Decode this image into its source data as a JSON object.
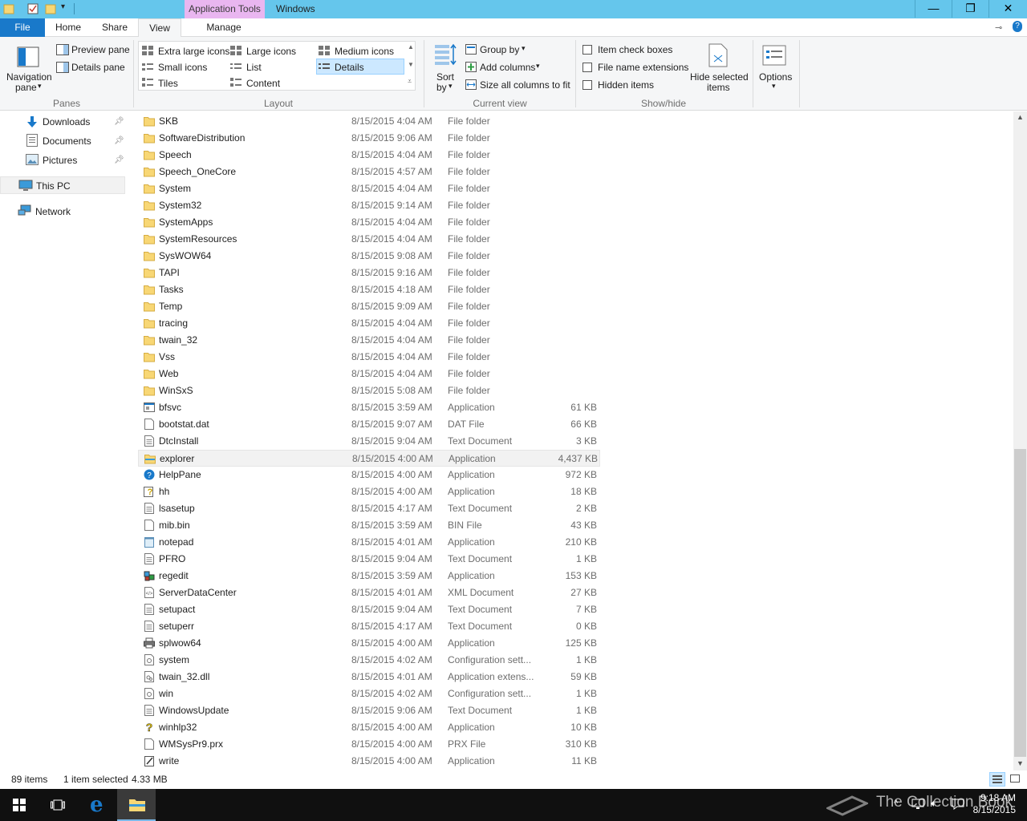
{
  "titlebar": {
    "context_tab": "Application Tools",
    "title": "Windows",
    "buttons": {
      "minimize": "—",
      "restore": "❐",
      "close": "✕"
    }
  },
  "tabs": {
    "file": "File",
    "home": "Home",
    "share": "Share",
    "view": "View",
    "manage": "Manage"
  },
  "ribbon": {
    "panes": {
      "navigation_pane": "Navigation",
      "navigation_pane2": "pane",
      "preview_pane": "Preview pane",
      "details_pane": "Details pane",
      "group": "Panes"
    },
    "layout": {
      "extra_large": "Extra large icons",
      "large": "Large icons",
      "medium": "Medium icons",
      "small": "Small icons",
      "list": "List",
      "details": "Details",
      "tiles": "Tiles",
      "content": "Content",
      "group": "Layout"
    },
    "current_view": {
      "sort_by": "Sort",
      "sort_by2": "by",
      "group_by": "Group by",
      "add_columns": "Add columns",
      "size_all": "Size all columns to fit",
      "group": "Current view"
    },
    "show_hide": {
      "item_check_boxes": "Item check boxes",
      "file_name_extensions": "File name extensions",
      "hidden_items": "Hidden items",
      "hide_selected": "Hide selected",
      "hide_selected2": "items",
      "group": "Show/hide"
    },
    "options": "Options"
  },
  "nav": {
    "items": [
      {
        "label": "Downloads",
        "icon": "download-arrow-icon",
        "pinned": true
      },
      {
        "label": "Documents",
        "icon": "documents-icon",
        "pinned": true
      },
      {
        "label": "Pictures",
        "icon": "pictures-icon",
        "pinned": true
      },
      {
        "label": "This PC",
        "icon": "computer-icon",
        "pinned": false
      },
      {
        "label": "Network",
        "icon": "network-icon",
        "pinned": false
      }
    ]
  },
  "files": [
    {
      "name": "SKB",
      "date": "8/15/2015 4:04 AM",
      "type": "File folder",
      "size": "",
      "icon": "folder"
    },
    {
      "name": "SoftwareDistribution",
      "date": "8/15/2015 9:06 AM",
      "type": "File folder",
      "size": "",
      "icon": "folder"
    },
    {
      "name": "Speech",
      "date": "8/15/2015 4:04 AM",
      "type": "File folder",
      "size": "",
      "icon": "folder"
    },
    {
      "name": "Speech_OneCore",
      "date": "8/15/2015 4:57 AM",
      "type": "File folder",
      "size": "",
      "icon": "folder"
    },
    {
      "name": "System",
      "date": "8/15/2015 4:04 AM",
      "type": "File folder",
      "size": "",
      "icon": "folder"
    },
    {
      "name": "System32",
      "date": "8/15/2015 9:14 AM",
      "type": "File folder",
      "size": "",
      "icon": "folder"
    },
    {
      "name": "SystemApps",
      "date": "8/15/2015 4:04 AM",
      "type": "File folder",
      "size": "",
      "icon": "folder"
    },
    {
      "name": "SystemResources",
      "date": "8/15/2015 4:04 AM",
      "type": "File folder",
      "size": "",
      "icon": "folder"
    },
    {
      "name": "SysWOW64",
      "date": "8/15/2015 9:08 AM",
      "type": "File folder",
      "size": "",
      "icon": "folder"
    },
    {
      "name": "TAPI",
      "date": "8/15/2015 9:16 AM",
      "type": "File folder",
      "size": "",
      "icon": "folder"
    },
    {
      "name": "Tasks",
      "date": "8/15/2015 4:18 AM",
      "type": "File folder",
      "size": "",
      "icon": "folder"
    },
    {
      "name": "Temp",
      "date": "8/15/2015 9:09 AM",
      "type": "File folder",
      "size": "",
      "icon": "folder"
    },
    {
      "name": "tracing",
      "date": "8/15/2015 4:04 AM",
      "type": "File folder",
      "size": "",
      "icon": "folder"
    },
    {
      "name": "twain_32",
      "date": "8/15/2015 4:04 AM",
      "type": "File folder",
      "size": "",
      "icon": "folder"
    },
    {
      "name": "Vss",
      "date": "8/15/2015 4:04 AM",
      "type": "File folder",
      "size": "",
      "icon": "folder"
    },
    {
      "name": "Web",
      "date": "8/15/2015 4:04 AM",
      "type": "File folder",
      "size": "",
      "icon": "folder"
    },
    {
      "name": "WinSxS",
      "date": "8/15/2015 5:08 AM",
      "type": "File folder",
      "size": "",
      "icon": "folder"
    },
    {
      "name": "bfsvc",
      "date": "8/15/2015 3:59 AM",
      "type": "Application",
      "size": "61 KB",
      "icon": "app"
    },
    {
      "name": "bootstat.dat",
      "date": "8/15/2015 9:07 AM",
      "type": "DAT File",
      "size": "66 KB",
      "icon": "file"
    },
    {
      "name": "DtcInstall",
      "date": "8/15/2015 9:04 AM",
      "type": "Text Document",
      "size": "3 KB",
      "icon": "text"
    },
    {
      "name": "explorer",
      "date": "8/15/2015 4:00 AM",
      "type": "Application",
      "size": "4,437 KB",
      "icon": "explorer",
      "selected": true
    },
    {
      "name": "HelpPane",
      "date": "8/15/2015 4:00 AM",
      "type": "Application",
      "size": "972 KB",
      "icon": "help"
    },
    {
      "name": "hh",
      "date": "8/15/2015 4:00 AM",
      "type": "Application",
      "size": "18 KB",
      "icon": "hh"
    },
    {
      "name": "lsasetup",
      "date": "8/15/2015 4:17 AM",
      "type": "Text Document",
      "size": "2 KB",
      "icon": "text"
    },
    {
      "name": "mib.bin",
      "date": "8/15/2015 3:59 AM",
      "type": "BIN File",
      "size": "43 KB",
      "icon": "file"
    },
    {
      "name": "notepad",
      "date": "8/15/2015 4:01 AM",
      "type": "Application",
      "size": "210 KB",
      "icon": "notepad"
    },
    {
      "name": "PFRO",
      "date": "8/15/2015 9:04 AM",
      "type": "Text Document",
      "size": "1 KB",
      "icon": "text"
    },
    {
      "name": "regedit",
      "date": "8/15/2015 3:59 AM",
      "type": "Application",
      "size": "153 KB",
      "icon": "regedit"
    },
    {
      "name": "ServerDataCenter",
      "date": "8/15/2015 4:01 AM",
      "type": "XML Document",
      "size": "27 KB",
      "icon": "xml"
    },
    {
      "name": "setupact",
      "date": "8/15/2015 9:04 AM",
      "type": "Text Document",
      "size": "7 KB",
      "icon": "text"
    },
    {
      "name": "setuperr",
      "date": "8/15/2015 4:17 AM",
      "type": "Text Document",
      "size": "0 KB",
      "icon": "text"
    },
    {
      "name": "splwow64",
      "date": "8/15/2015 4:00 AM",
      "type": "Application",
      "size": "125 KB",
      "icon": "printer"
    },
    {
      "name": "system",
      "date": "8/15/2015 4:02 AM",
      "type": "Configuration sett...",
      "size": "1 KB",
      "icon": "config"
    },
    {
      "name": "twain_32.dll",
      "date": "8/15/2015 4:01 AM",
      "type": "Application extens...",
      "size": "59 KB",
      "icon": "dll"
    },
    {
      "name": "win",
      "date": "8/15/2015 4:02 AM",
      "type": "Configuration sett...",
      "size": "1 KB",
      "icon": "config"
    },
    {
      "name": "WindowsUpdate",
      "date": "8/15/2015 9:06 AM",
      "type": "Text Document",
      "size": "1 KB",
      "icon": "text"
    },
    {
      "name": "winhlp32",
      "date": "8/15/2015 4:00 AM",
      "type": "Application",
      "size": "10 KB",
      "icon": "help-yellow"
    },
    {
      "name": "WMSysPr9.prx",
      "date": "8/15/2015 4:00 AM",
      "type": "PRX File",
      "size": "310 KB",
      "icon": "file"
    },
    {
      "name": "write",
      "date": "8/15/2015 4:00 AM",
      "type": "Application",
      "size": "11 KB",
      "icon": "write"
    }
  ],
  "status": {
    "count": "89 items",
    "selected": "1 item selected",
    "size": "4.33 MB"
  },
  "taskbar": {
    "time": "9:18 AM",
    "date": "8/15/2015",
    "watermark": "The Collection Book"
  },
  "colors": {
    "titlebar": "#65c6ec",
    "file_tab": "#1979ca",
    "context_tab": "#e9b6f0",
    "folder": "#f8d775"
  }
}
